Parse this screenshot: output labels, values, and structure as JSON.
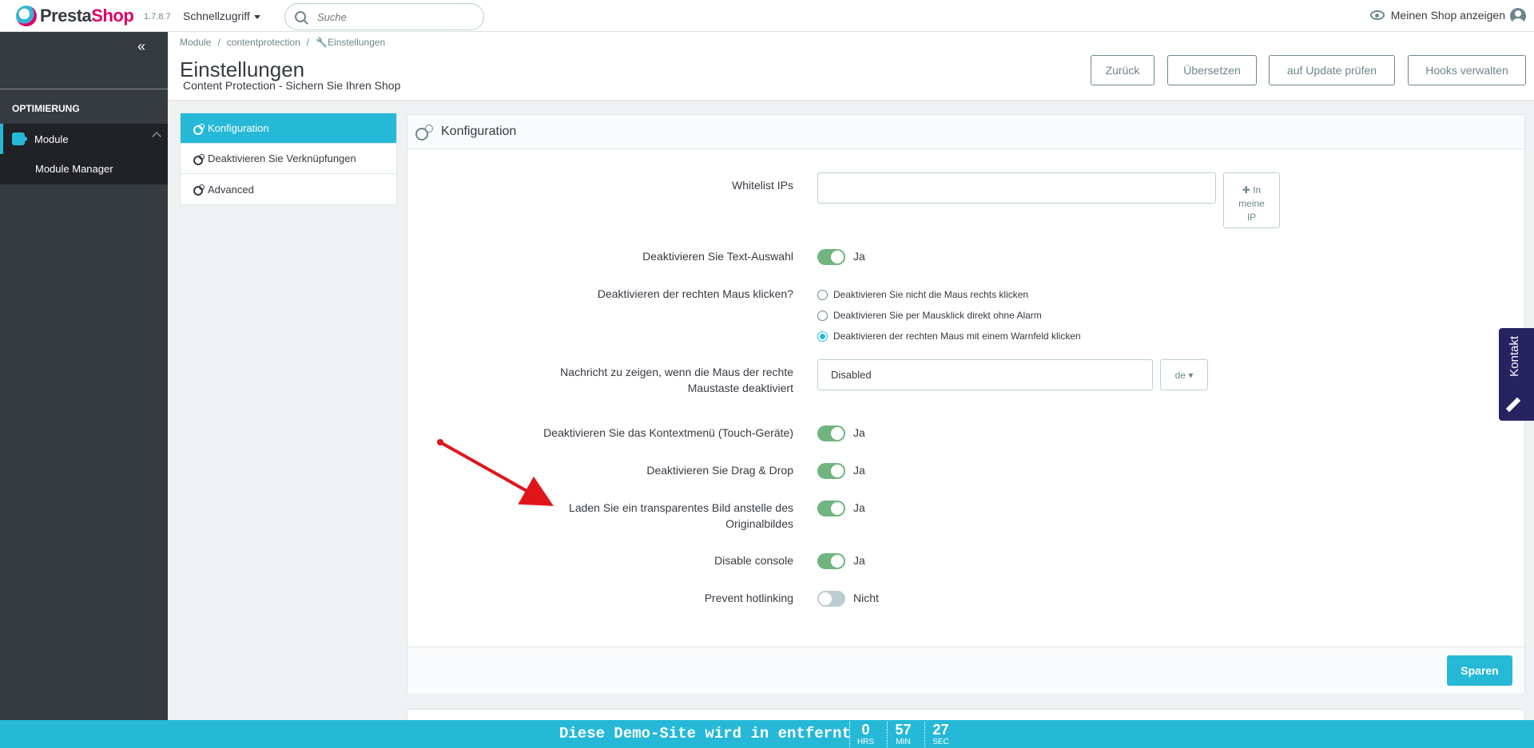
{
  "header": {
    "logo_text_1": "Presta",
    "logo_text_2": "Shop",
    "version": "1.7.8.7",
    "quick_access": "Schnellzugriff",
    "search_placeholder": "Suche",
    "view_shop": "Meinen Shop anzeigen"
  },
  "sidebar": {
    "section": "OPTIMIERUNG",
    "item": "Module",
    "sub_item": "Module Manager"
  },
  "toolbar": {
    "breadcrumb": [
      "Module",
      "contentprotection",
      "Einstellungen"
    ],
    "title": "Einstellungen",
    "subtitle": "Content Protection - Sichern Sie Ihren Shop",
    "buttons": [
      "Zurück",
      "Übersetzen",
      "auf Update prüfen",
      "Hooks verwalten"
    ]
  },
  "tabs": [
    "Konfiguration",
    "Deaktivieren Sie Verknüpfungen",
    "Advanced"
  ],
  "panel": {
    "title": "Konfiguration",
    "whitelist_label": "Whitelist IPs",
    "whitelist_value": "",
    "ip_button": [
      "In",
      "meine",
      "IP"
    ],
    "text_selection_label": "Deaktivieren Sie Text-Auswahl",
    "text_selection_value": "Ja",
    "right_click_label": "Deaktivieren der rechten Maus klicken?",
    "right_click_options": [
      "Deaktivieren Sie nicht die Maus rechts klicken",
      "Deaktivieren Sie per Mausklick direkt ohne Alarm",
      "Deaktivieren der rechten Maus mit einem Warnfeld klicken"
    ],
    "right_click_selected": 2,
    "message_label_1": "Nachricht zu zeigen, wenn die Maus der rechte",
    "message_label_2": "Maustaste deaktiviert",
    "message_value": "Disabled",
    "language": "de",
    "context_menu_label": "Deaktivieren Sie das Kontextmenü (Touch-Geräte)",
    "context_menu_value": "Ja",
    "drag_drop_label": "Deaktivieren Sie Drag & Drop",
    "drag_drop_value": "Ja",
    "transparent_label_1": "Laden Sie ein transparentes Bild anstelle des",
    "transparent_label_2": "Originalbildes",
    "transparent_value": "Ja",
    "console_label": "Disable console",
    "console_value": "Ja",
    "hotlink_label": "Prevent hotlinking",
    "hotlink_value": "Nicht",
    "save": "Sparen"
  },
  "contact": "Kontakt",
  "demo_bar": {
    "text": "Diese Demo-Site wird in entfernt",
    "hours": "0",
    "hours_unit": "HRS",
    "minutes": "57",
    "minutes_unit": "MIN",
    "seconds": "27",
    "seconds_unit": "SEC"
  },
  "colors": {
    "accent": "#25b9d7",
    "sidebar": "#363a41",
    "toggle_on": "#70b580",
    "contact": "#272361",
    "annotation_arrow": "#e0151b"
  }
}
